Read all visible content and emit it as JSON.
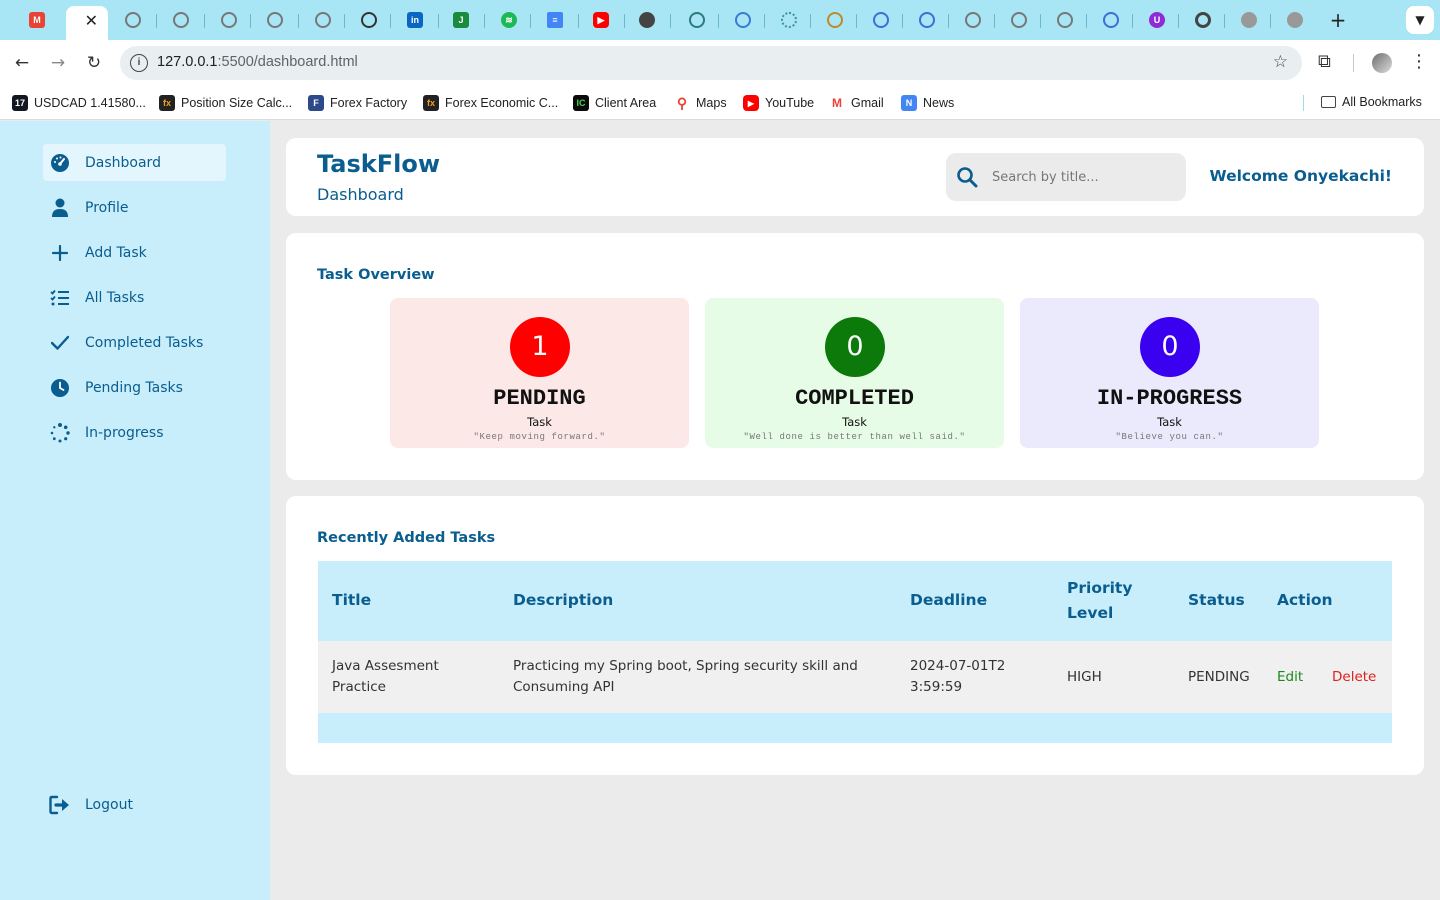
{
  "browser": {
    "url_host": "127.0.0.1",
    "url_path": ":5500/dashboard.html",
    "bookmarks": [
      {
        "label": "USDCAD 1.41580...",
        "icon": "tradingview-icon",
        "color": "#131722",
        "glyph": "17"
      },
      {
        "label": "Position Size Calc...",
        "icon": "fx-icon",
        "color": "#1a1a1a",
        "glyph": "fx"
      },
      {
        "label": "Forex Factory",
        "icon": "forex-factory-icon",
        "color": "#2c4a8a",
        "glyph": "F"
      },
      {
        "label": "Forex Economic C...",
        "icon": "fx-icon",
        "color": "#1a1a1a",
        "glyph": "fx"
      },
      {
        "label": "Client Area",
        "icon": "client-area-icon",
        "color": "#0b0b0b",
        "glyph": "IC"
      },
      {
        "label": "Maps",
        "icon": "maps-icon",
        "color": "#34a853",
        "glyph": "●"
      },
      {
        "label": "YouTube",
        "icon": "youtube-icon",
        "color": "#ff0000",
        "glyph": "▶"
      },
      {
        "label": "Gmail",
        "icon": "gmail-icon",
        "color": "#ea4335",
        "glyph": "M"
      },
      {
        "label": "News",
        "icon": "news-icon",
        "color": "#4285f4",
        "glyph": "N"
      }
    ],
    "all_bookmarks": "All Bookmarks"
  },
  "app": {
    "brand": "TaskFlow",
    "page_title": "Dashboard",
    "search_placeholder": "Search by title...",
    "welcome": "Welcome Onyekachi!",
    "accent_color": "#0a5d8f",
    "sidebar": {
      "items": [
        {
          "label": "Dashboard",
          "icon": "dashboard-gauge-icon"
        },
        {
          "label": "Profile",
          "icon": "user-icon"
        },
        {
          "label": "Add Task",
          "icon": "plus-icon"
        },
        {
          "label": "All Tasks",
          "icon": "list-check-icon"
        },
        {
          "label": "Completed Tasks",
          "icon": "check-icon"
        },
        {
          "label": "Pending Tasks",
          "icon": "clock-icon"
        },
        {
          "label": "In-progress",
          "icon": "spinner-icon"
        }
      ],
      "logout": "Logout"
    },
    "overview": {
      "title": "Task Overview",
      "stats": [
        {
          "count": "1",
          "name": "PENDING",
          "sub": "Task",
          "quote": "\"Keep moving forward.\"",
          "bg": "#fde8e8",
          "badge": "#ff0000"
        },
        {
          "count": "0",
          "name": "COMPLETED",
          "sub": "Task",
          "quote": "\"Well done is better than well said.\"",
          "bg": "#e6fce6",
          "badge": "#0b7a0b"
        },
        {
          "count": "0",
          "name": "IN-PROGRESS",
          "sub": "Task",
          "quote": "\"Believe you can.\"",
          "bg": "#ebe9fc",
          "badge": "#3a00f0"
        }
      ]
    },
    "recent": {
      "title": "Recently Added Tasks",
      "headers": [
        "Title",
        "Description",
        "Deadline",
        "Priority Level",
        "Status",
        "Action"
      ],
      "rows": [
        {
          "title": "Java Assesment Practice",
          "description": "Practicing my Spring boot, Spring security skill and Consuming API",
          "deadline": "2024-07-01T23:59:59",
          "priority": "HIGH",
          "status": "PENDING",
          "edit": "Edit",
          "delete": "Delete"
        }
      ]
    }
  }
}
